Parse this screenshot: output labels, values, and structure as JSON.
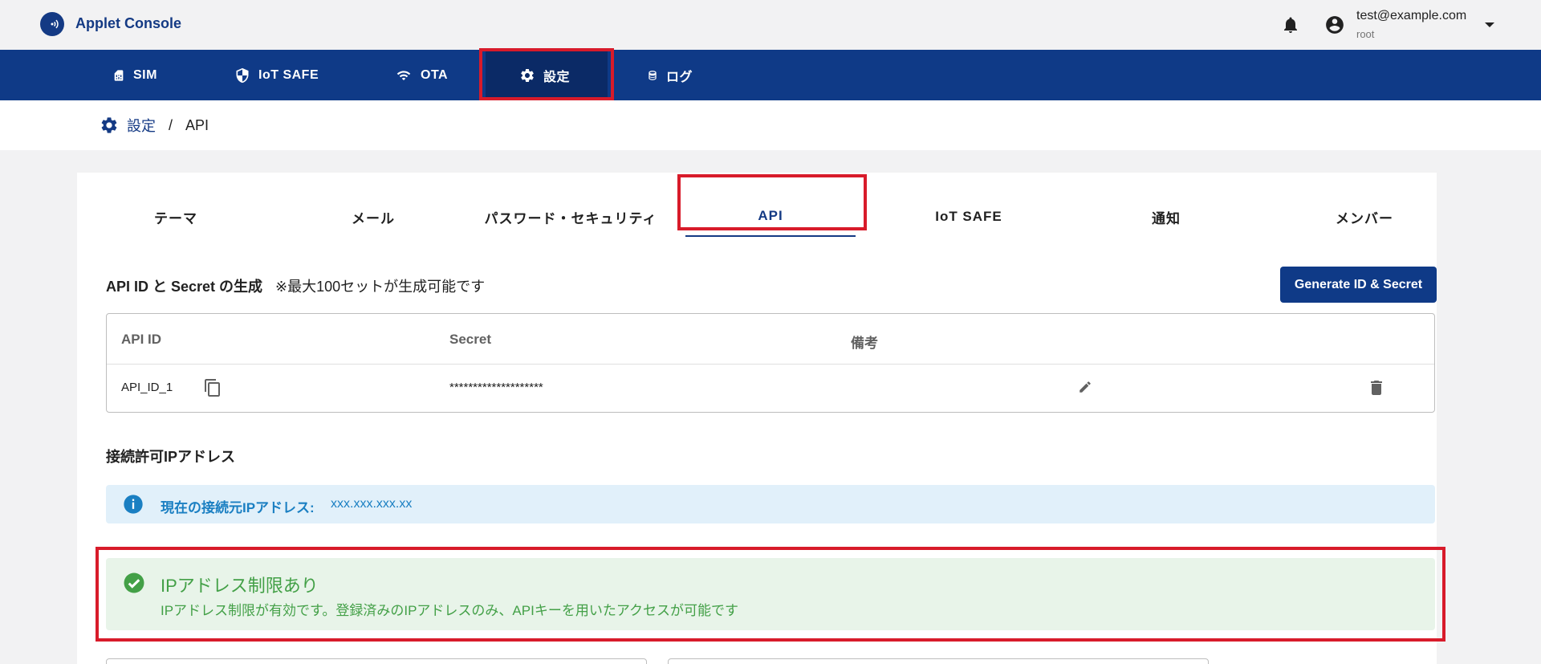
{
  "app": {
    "title": "Applet Console"
  },
  "user": {
    "email": "test@example.com",
    "role": "root"
  },
  "nav": {
    "items": [
      {
        "label": "SIM",
        "icon": "sim-card-icon"
      },
      {
        "label": "IoT SAFE",
        "icon": "shield-icon"
      },
      {
        "label": "OTA",
        "icon": "wifi-icon"
      },
      {
        "label": "設定",
        "icon": "gear-icon",
        "active": true
      },
      {
        "label": "ログ",
        "icon": "database-icon"
      }
    ]
  },
  "breadcrumb": {
    "parent": "設定",
    "separator": "/",
    "current": "API"
  },
  "tabs": [
    {
      "label": "テーマ"
    },
    {
      "label": "メール"
    },
    {
      "label": "パスワード・セキュリティ"
    },
    {
      "label": "API",
      "active": true
    },
    {
      "label": "IoT SAFE"
    },
    {
      "label": "通知"
    },
    {
      "label": "メンバー"
    }
  ],
  "api_section": {
    "title": "API ID と Secret の生成",
    "note": "※最大100セットが生成可能です",
    "generate_button": "Generate ID & Secret",
    "table": {
      "headers": {
        "api_id": "API ID",
        "secret": "Secret",
        "remark": "備考"
      },
      "rows": [
        {
          "api_id": "API_ID_1",
          "secret": "********************",
          "remark": ""
        }
      ]
    }
  },
  "ip_section": {
    "title": "接続許可IPアドレス",
    "current_ip_label": "現在の接続元IPアドレス:",
    "current_ip_value": "xxx.xxx.xxx.xx",
    "status_title": "IPアドレス制限あり",
    "status_desc": "IPアドレス制限が有効です。登録済みのIPアドレスのみ、APIキーを用いたアクセスが可能です"
  },
  "colors": {
    "brand": "#0f3a87",
    "highlight": "#d81b2a",
    "info_bg": "#e1f0fa",
    "info_text": "#1a7fc2",
    "success_bg": "#e8f4e9",
    "success_text": "#43a047"
  }
}
